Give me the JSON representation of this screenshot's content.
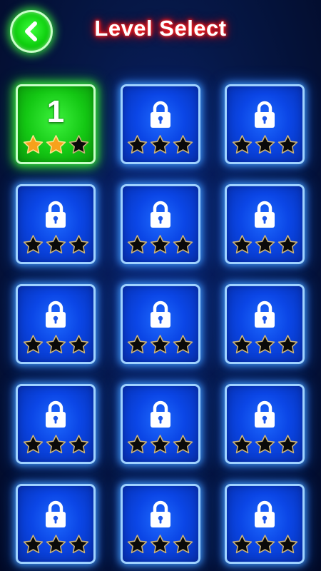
{
  "header": {
    "title": "Level Select",
    "back_icon": "chevron-left-icon"
  },
  "colors": {
    "title_glow": "#ff2020",
    "locked_tile": "#0b46e6",
    "unlocked_tile": "#14c814",
    "star_earned": "#f7a21b",
    "star_empty": "#0a0a0a"
  },
  "levels": [
    {
      "label": "1",
      "locked": false,
      "stars_earned": 2,
      "stars_total": 3
    },
    {
      "label": "",
      "locked": true,
      "stars_earned": 0,
      "stars_total": 3
    },
    {
      "label": "",
      "locked": true,
      "stars_earned": 0,
      "stars_total": 3
    },
    {
      "label": "",
      "locked": true,
      "stars_earned": 0,
      "stars_total": 3
    },
    {
      "label": "",
      "locked": true,
      "stars_earned": 0,
      "stars_total": 3
    },
    {
      "label": "",
      "locked": true,
      "stars_earned": 0,
      "stars_total": 3
    },
    {
      "label": "",
      "locked": true,
      "stars_earned": 0,
      "stars_total": 3
    },
    {
      "label": "",
      "locked": true,
      "stars_earned": 0,
      "stars_total": 3
    },
    {
      "label": "",
      "locked": true,
      "stars_earned": 0,
      "stars_total": 3
    },
    {
      "label": "",
      "locked": true,
      "stars_earned": 0,
      "stars_total": 3
    },
    {
      "label": "",
      "locked": true,
      "stars_earned": 0,
      "stars_total": 3
    },
    {
      "label": "",
      "locked": true,
      "stars_earned": 0,
      "stars_total": 3
    },
    {
      "label": "",
      "locked": true,
      "stars_earned": 0,
      "stars_total": 3
    },
    {
      "label": "",
      "locked": true,
      "stars_earned": 0,
      "stars_total": 3
    },
    {
      "label": "",
      "locked": true,
      "stars_earned": 0,
      "stars_total": 3
    }
  ]
}
